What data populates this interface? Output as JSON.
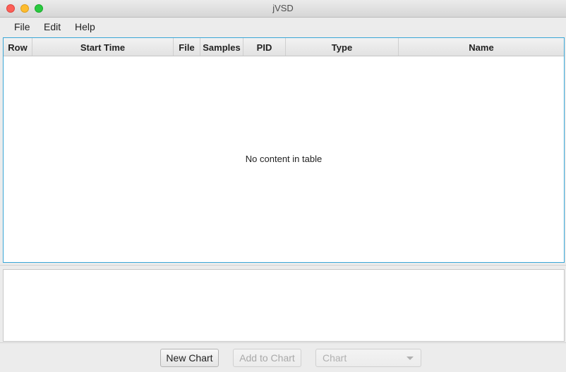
{
  "window": {
    "title": "jVSD"
  },
  "menubar": {
    "items": [
      "File",
      "Edit",
      "Help"
    ]
  },
  "table": {
    "columns": [
      "Row",
      "Start Time",
      "File",
      "Samples",
      "PID",
      "Type",
      "Name"
    ],
    "empty_message": "No content in table"
  },
  "toolbar": {
    "new_chart_label": "New Chart",
    "add_to_chart_label": "Add to Chart",
    "chart_select_value": "Chart"
  },
  "colors": {
    "focus_border": "#39a6d6",
    "close": "#fc5f57",
    "minimize": "#fdbc2e",
    "maximize": "#29c940"
  },
  "icons": [
    "close-window-icon",
    "minimize-window-icon",
    "maximize-window-icon",
    "chevron-down-icon"
  ]
}
